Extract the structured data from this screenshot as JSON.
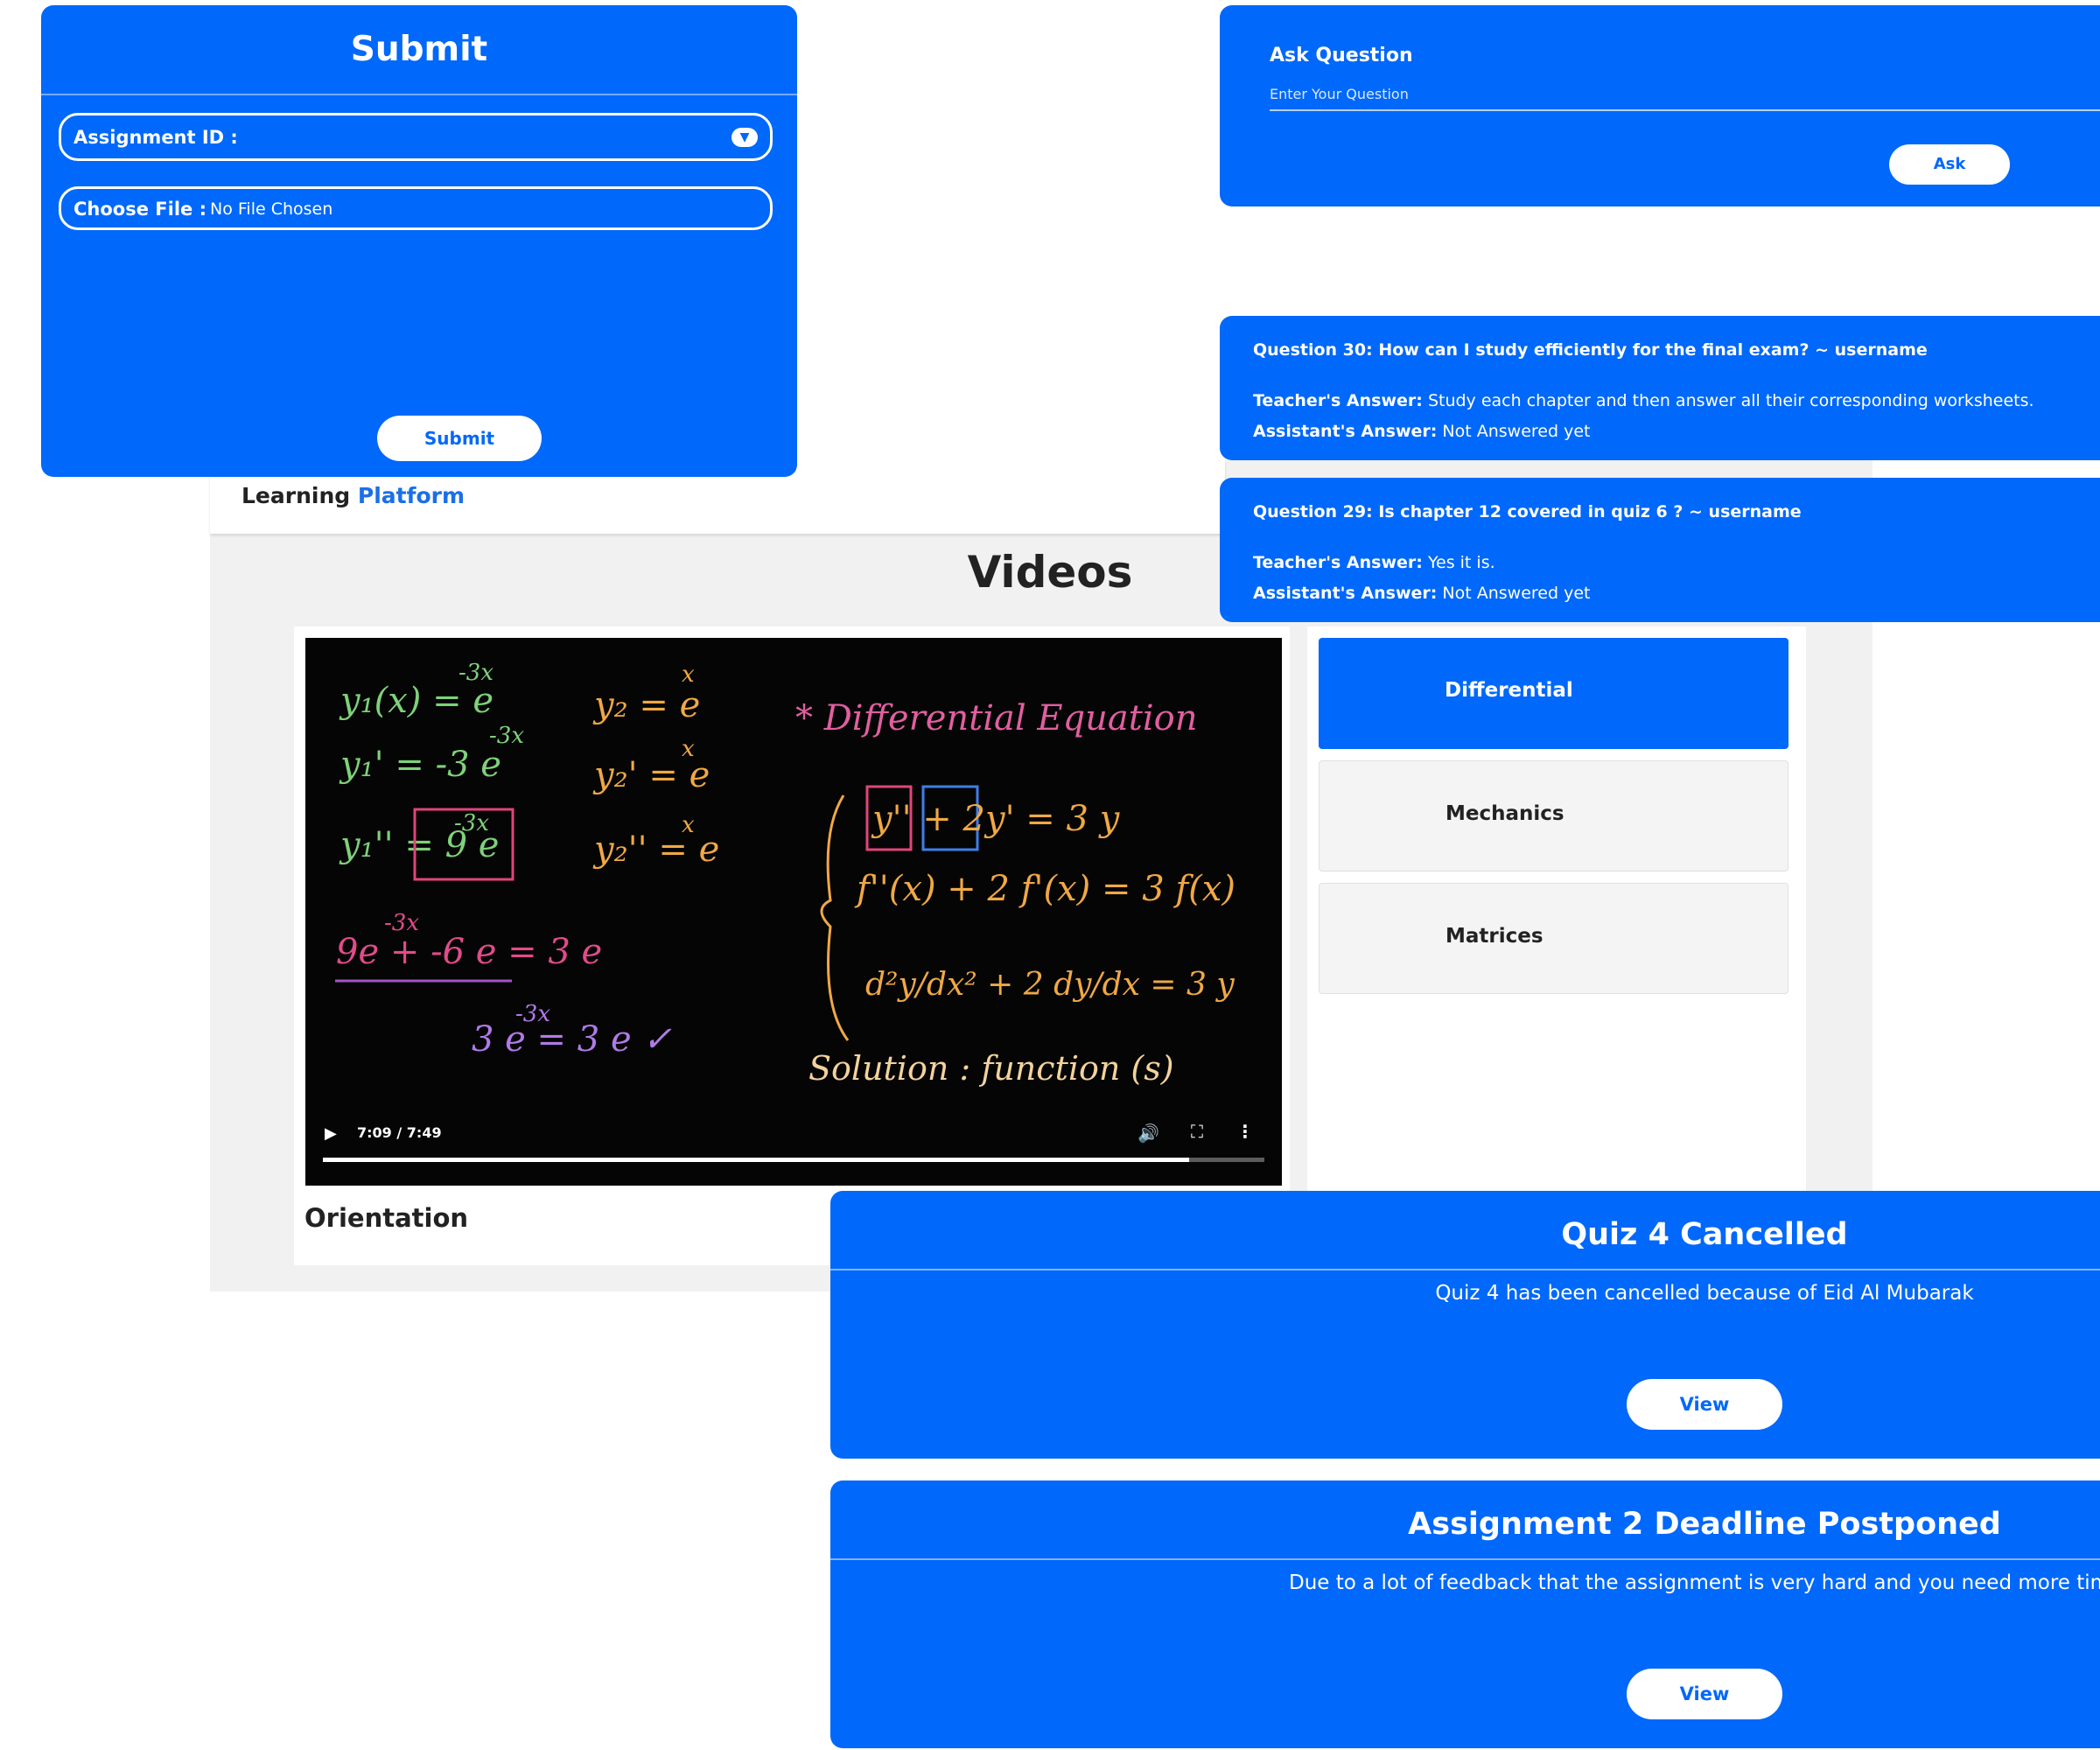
{
  "submit": {
    "title": "Submit",
    "assignment_label": "Assignment ID :",
    "file_label": "Choose File :",
    "file_value": "No File Chosen",
    "button": "Submit"
  },
  "ask": {
    "label": "Ask Question",
    "placeholder": "Enter Your Question",
    "button": "Ask"
  },
  "questions": [
    {
      "question": "Question 30: How can I study efficiently for the final exam? ~ username",
      "teacher_label": "Teacher's Answer:",
      "teacher_answer": "Study each chapter and then answer all their corresponding worksheets.",
      "assistant_label": "Assistant's Answer:",
      "assistant_answer": "Not Answered yet"
    },
    {
      "question": "Question 29: Is chapter 12 covered in quiz 6 ? ~ username",
      "teacher_label": "Teacher's Answer:",
      "teacher_answer": "Yes it is.",
      "assistant_label": "Assistant's Answer:",
      "assistant_answer": "Not Answered yet"
    }
  ],
  "navbar": {
    "brand_first": "Learning",
    "brand_second": "Platform"
  },
  "videos": {
    "title": "Videos",
    "video_label": "Orientation",
    "time": "7:09 / 7:49",
    "progress": 0.92,
    "topics": [
      {
        "label": "Differential",
        "active": true
      },
      {
        "label": "Mechanics",
        "active": false
      },
      {
        "label": "Matrices",
        "active": false
      }
    ]
  },
  "blackboard": {
    "heading": "* Differential Equation",
    "left_lines": [
      "y₁(x) = e",
      "y₁' = -3 e",
      "y₁'' = 9 e",
      "9e + -6 e = 3 e",
      "3 e = 3 e ✓"
    ],
    "left_exponents": [
      "-3x",
      "-3x",
      "-3x",
      "-3x",
      "-3x"
    ],
    "middle_lines": [
      "y₂ = e",
      "y₂' = e",
      "y₂'' = e"
    ],
    "middle_exponents": [
      "x",
      "x",
      "x"
    ],
    "right_lines": [
      "y'' + 2y' = 3 y",
      "f''(x) + 2 f'(x) = 3 f(x)",
      "d²y/dx² + 2 dy/dx = 3 y"
    ],
    "solution": "Solution : function (s)"
  },
  "announcements": [
    {
      "title": "Quiz 4 Cancelled",
      "body": "Quiz 4 has been cancelled because of Eid Al Mubarak",
      "button": "View"
    },
    {
      "title": "Assignment 2 Deadline Postponed",
      "body": "Due to a lot of feedback that the assignment is very hard and you need more tim",
      "button": "View"
    }
  ],
  "colors": {
    "primary": "#0068fa",
    "page_bg": "#f1f1f1",
    "brand_accent": "#1b6fe8"
  }
}
